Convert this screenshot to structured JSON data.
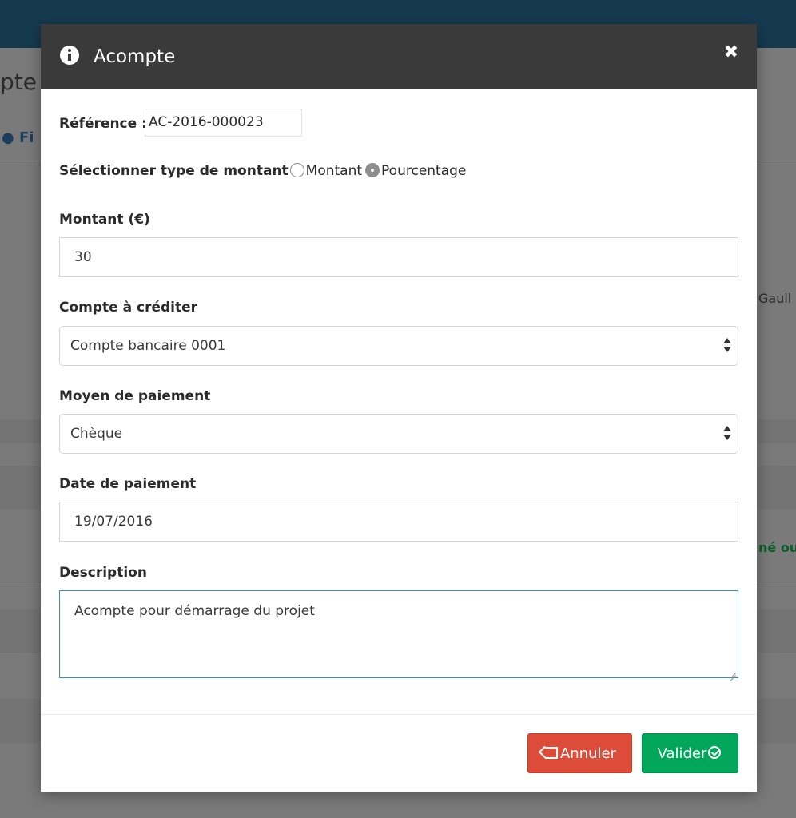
{
  "background": {
    "page_title_fragment": "pte",
    "user_link_fragment": "Fi",
    "side_text_1": "Gaull",
    "side_text_2": "né ou"
  },
  "modal": {
    "title": "Acompte",
    "close_symbol": "✖",
    "reference": {
      "label": "Référence :",
      "value": "AC-2016-000023"
    },
    "amount_type": {
      "label": "Sélectionner type de montant",
      "options": [
        {
          "label": "Montant",
          "checked": false
        },
        {
          "label": "Pourcentage",
          "checked": true
        }
      ]
    },
    "amount": {
      "label": "Montant (€)",
      "value": "30"
    },
    "account": {
      "label": "Compte à créditer",
      "selected": "Compte bancaire 0001"
    },
    "payment_method": {
      "label": "Moyen de paiement",
      "selected": "Chèque"
    },
    "payment_date": {
      "label": "Date de paiement",
      "value": "19/07/2016"
    },
    "description": {
      "label": "Description",
      "value": "Acompte pour démarrage du projet"
    },
    "buttons": {
      "cancel": "Annuler",
      "ok": "Valider"
    }
  },
  "colors": {
    "header_bg": "#3a3a3a",
    "cancel_btn": "#dd4b39",
    "ok_btn": "#00a65a",
    "focus_border": "#3c8dbc",
    "top_bar": "#153a4f"
  }
}
